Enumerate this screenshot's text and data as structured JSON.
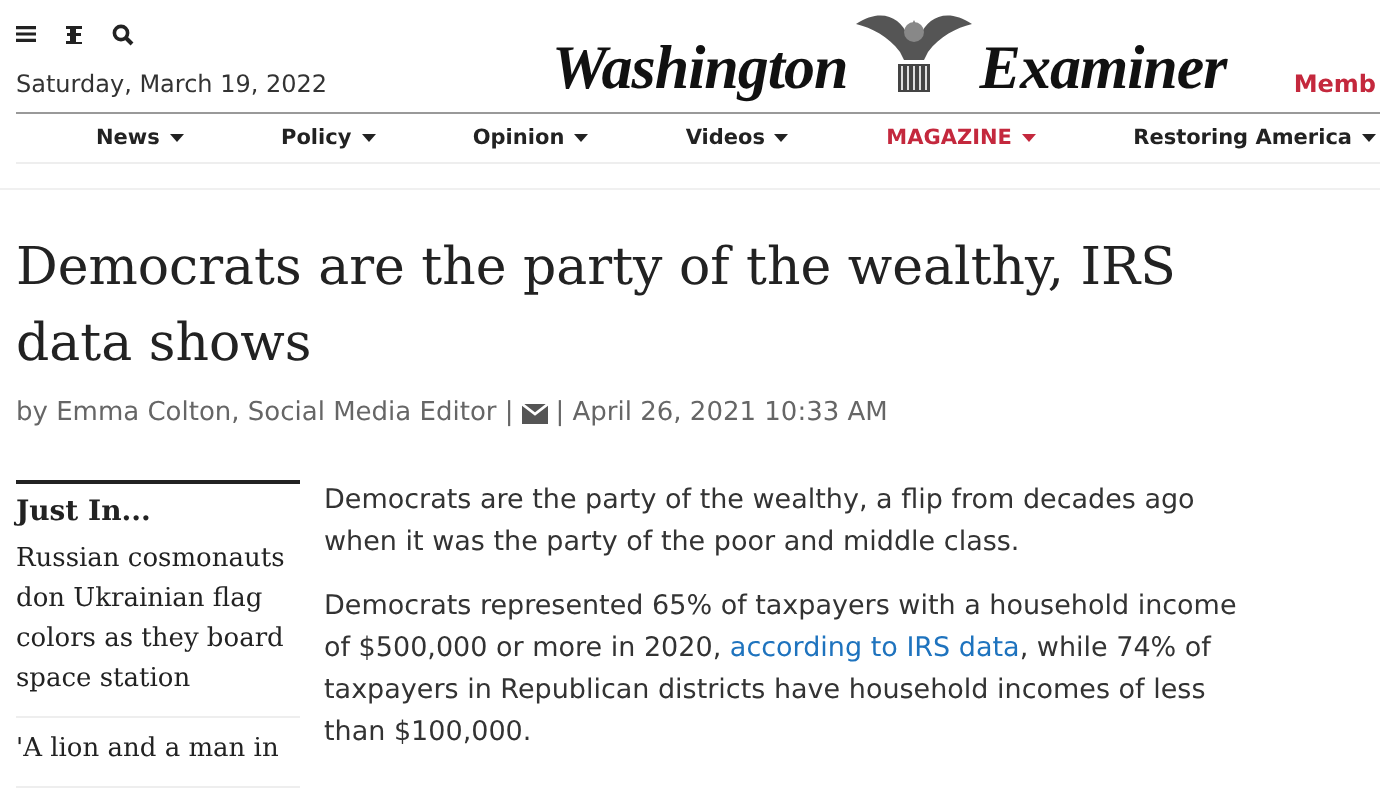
{
  "header": {
    "date": "Saturday, March 19, 2022",
    "logo_left": "Washington",
    "logo_right": "Examiner",
    "member_link": "Memb"
  },
  "nav": [
    {
      "label": "News",
      "color": "#222222"
    },
    {
      "label": "Policy",
      "color": "#222222"
    },
    {
      "label": "Opinion",
      "color": "#222222"
    },
    {
      "label": "Videos",
      "color": "#222222"
    },
    {
      "label": "MAGAZINE",
      "color": "#c4283d"
    },
    {
      "label": "Restoring America",
      "color": "#222222"
    }
  ],
  "article": {
    "title": "Democrats are the party of the wealthy, IRS data shows",
    "byline_author": "by Emma Colton, Social Media Editor |",
    "byline_date": "| April 26, 2021 10:33 AM",
    "paragraphs": [
      {
        "parts": [
          {
            "text": "Democrats are the party of the wealthy, a flip from decades ago when it was the party of the poor and middle class.",
            "kind": "text"
          }
        ]
      },
      {
        "parts": [
          {
            "text": "Democrats represented 65% of taxpayers with a household income of $500,000 or more in 2020, ",
            "kind": "text"
          },
          {
            "text": "according to IRS data",
            "kind": "link"
          },
          {
            "text": ", while 74% of taxpayers in Republican districts have household incomes of less than $100,000.",
            "kind": "text"
          }
        ]
      }
    ]
  },
  "sidebar": {
    "heading": "Just In...",
    "items": [
      "Russian cosmonauts don Ukrainian flag colors as they board space station",
      "'A lion and a man in"
    ]
  }
}
